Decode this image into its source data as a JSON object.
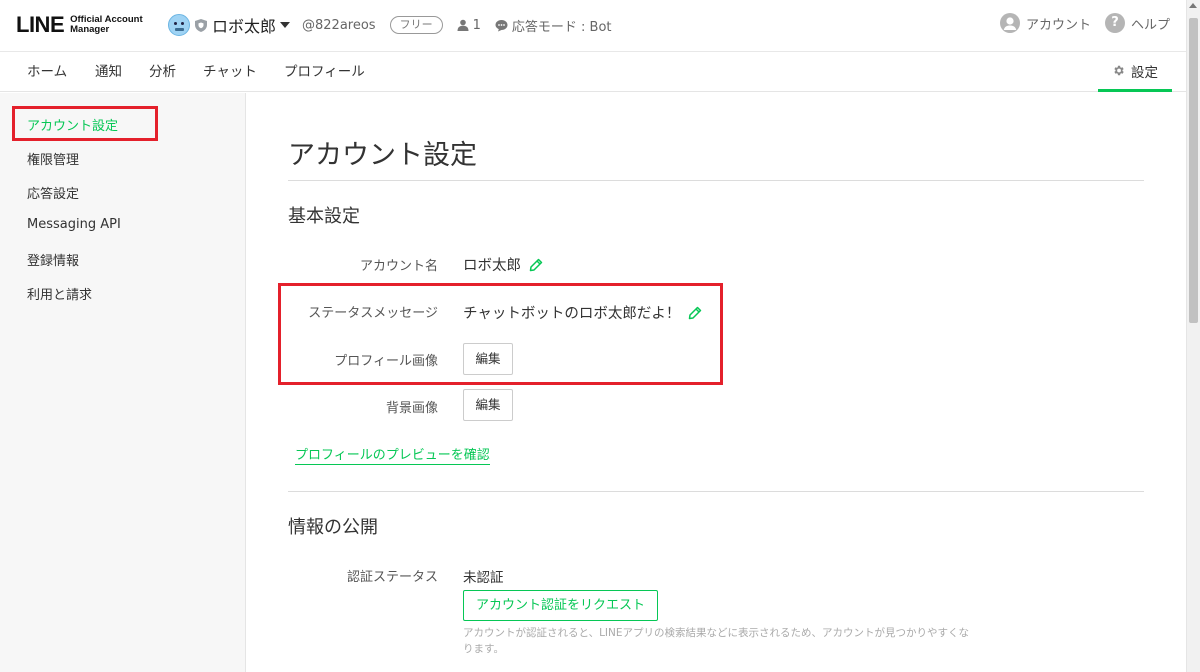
{
  "header": {
    "logo_text": "LINE",
    "logo_sub_line1": "Official Account",
    "logo_sub_line2": "Manager",
    "account_name": "ロボ太郎",
    "account_id": "@822areos",
    "plan_badge": "フリー",
    "friend_count": "1",
    "response_mode": "応答モード : Bot",
    "account_link": "アカウント",
    "help_link": "ヘルプ",
    "icons": [
      "avatar",
      "shield-icon",
      "caret-down-icon",
      "person-icon",
      "chat-bubble-icon",
      "user-circle-icon",
      "question-icon"
    ]
  },
  "nav": {
    "items": [
      "ホーム",
      "通知",
      "分析",
      "チャット",
      "プロフィール"
    ],
    "settings": "設定"
  },
  "sidebar": {
    "items": [
      "アカウント設定",
      "権限管理",
      "応答設定",
      "Messaging API",
      "登録情報",
      "利用と請求"
    ],
    "active_index": 0
  },
  "main": {
    "page_title": "アカウント設定",
    "basic": {
      "title": "基本設定",
      "account_name_label": "アカウント名",
      "account_name_value": "ロボ太郎",
      "status_label": "ステータスメッセージ",
      "status_value": "チャットボットのロボ太郎だよ！",
      "profile_image_label": "プロフィール画像",
      "background_image_label": "背景画像",
      "edit_label": "編集",
      "preview_link": "プロフィールのプレビューを確認"
    },
    "publish": {
      "title": "情報の公開",
      "cert_label": "認証ステータス",
      "cert_value": "未認証",
      "request_button": "アカウント認証をリクエスト",
      "note": "アカウントが認証されると、LINEアプリの検索結果などに表示されるため、アカウントが見つかりやすくなります。"
    }
  },
  "colors": {
    "accent_green": "#06c755",
    "highlight_red": "#e4202b"
  }
}
